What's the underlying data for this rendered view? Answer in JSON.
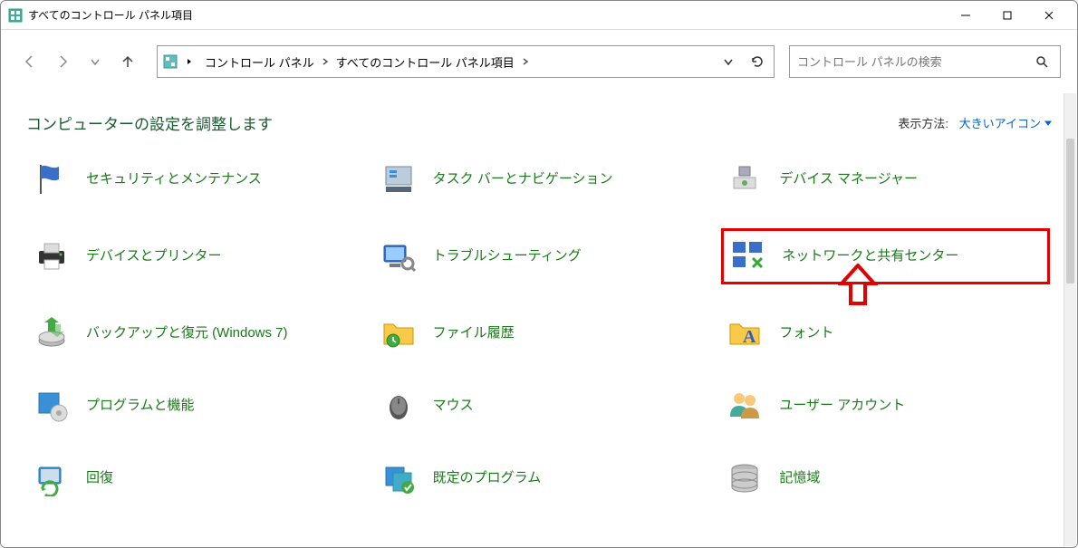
{
  "window": {
    "title": "すべてのコントロール パネル項目"
  },
  "breadcrumb": {
    "parts": [
      "コントロール パネル",
      "すべてのコントロール パネル項目"
    ]
  },
  "search": {
    "placeholder": "コントロール パネルの検索"
  },
  "heading": "コンピューターの設定を調整します",
  "view_by": {
    "label": "表示方法:",
    "value": "大きいアイコン"
  },
  "items": [
    {
      "label": "セキュリティとメンテナンス",
      "icon": "flag",
      "highlighted": false
    },
    {
      "label": "タスク バーとナビゲーション",
      "icon": "taskbar",
      "highlighted": false
    },
    {
      "label": "デバイス マネージャー",
      "icon": "device-mgr",
      "highlighted": false
    },
    {
      "label": "デバイスとプリンター",
      "icon": "printer",
      "highlighted": false
    },
    {
      "label": "トラブルシューティング",
      "icon": "troubleshoot",
      "highlighted": false
    },
    {
      "label": "ネットワークと共有センター",
      "icon": "network",
      "highlighted": true
    },
    {
      "label": "バックアップと復元 (Windows 7)",
      "icon": "backup",
      "highlighted": false
    },
    {
      "label": "ファイル履歴",
      "icon": "file-history",
      "highlighted": false
    },
    {
      "label": "フォント",
      "icon": "font",
      "highlighted": false
    },
    {
      "label": "プログラムと機能",
      "icon": "programs",
      "highlighted": false
    },
    {
      "label": "マウス",
      "icon": "mouse",
      "highlighted": false
    },
    {
      "label": "ユーザー アカウント",
      "icon": "users",
      "highlighted": false
    },
    {
      "label": "回復",
      "icon": "recovery",
      "highlighted": false
    },
    {
      "label": "既定のプログラム",
      "icon": "defaults",
      "highlighted": false
    },
    {
      "label": "記憶域",
      "icon": "storage",
      "highlighted": false
    }
  ],
  "annotation": {
    "type": "red-arrow",
    "target_index": 5
  }
}
